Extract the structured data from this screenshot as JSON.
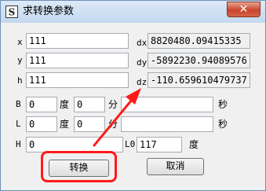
{
  "window": {
    "title": "求转换参数",
    "close_label": "✕"
  },
  "fields": {
    "x": {
      "label": "x",
      "value": "111"
    },
    "y": {
      "label": "y",
      "value": "111"
    },
    "h": {
      "label": "h",
      "value": "111"
    }
  },
  "results": {
    "dx": {
      "label": "dx",
      "value": "8820480.09415335"
    },
    "dy": {
      "label": "dy",
      "value": "-5892230.94089576"
    },
    "dz": {
      "label": "dz",
      "value": "-110.659610479737"
    }
  },
  "angles": {
    "B": {
      "label": "B",
      "deg": "0",
      "min": "0",
      "sec": ""
    },
    "L": {
      "label": "L",
      "deg": "0",
      "min": "0",
      "sec": ""
    },
    "unit_deg": "度",
    "unit_min": "分",
    "unit_sec": "秒"
  },
  "height_row": {
    "H_label": "H",
    "H_value": "0",
    "L0_label": "L0",
    "L0_value": "117",
    "L0_unit": "度"
  },
  "buttons": {
    "convert": "转换",
    "cancel": "取消"
  },
  "colors": {
    "annotation": "#ff1a1a"
  }
}
